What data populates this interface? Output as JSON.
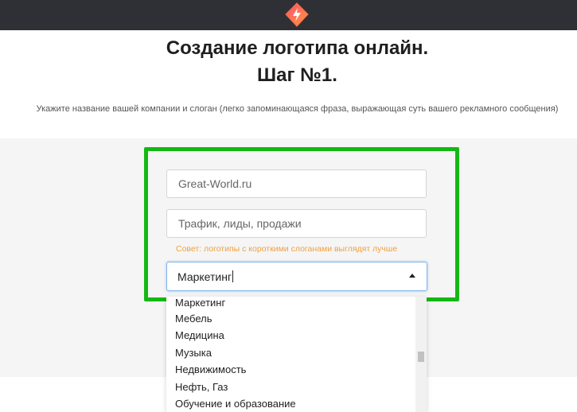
{
  "header": {
    "logo_icon": "red-orange-diamond-logo-icon",
    "background_color": "#2f3035"
  },
  "main": {
    "title_line1": "Создание логотипа онлайн.",
    "title_line2": "Шаг №1.",
    "subtitle": "Укажите название вашей компании и слоган (легко запоминающаяся фраза, выражающая суть вашего рекламного сообщения)"
  },
  "form": {
    "company_placeholder": "Great-World.ru",
    "slogan_placeholder": "Трафик, лиды, продажи",
    "hint": "Совет: логотипы с короткими слоганами выглядят лучше",
    "industry_value": "Маркетинг",
    "highlight_color": "#14b814",
    "hint_color": "#f0a040"
  },
  "dropdown": {
    "options": [
      "Маркетинг",
      "Мебель",
      "Медицина",
      "Музыка",
      "Недвижимость",
      "Нефть, Газ",
      "Обучение и образование"
    ]
  }
}
